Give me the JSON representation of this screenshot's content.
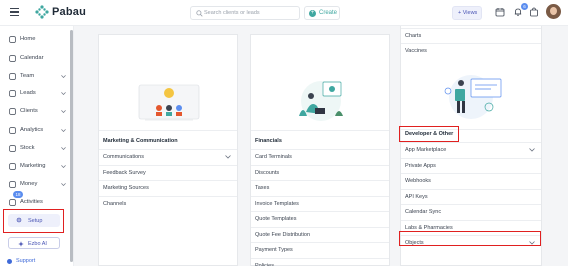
{
  "app": {
    "logo_text": "Pabau",
    "search_placeholder": "Search clients or leads",
    "create_label": "Create",
    "views_label": "+ Views",
    "notification_count": "6"
  },
  "sidebar": {
    "items": [
      {
        "label": "Home",
        "icon": "home-icon",
        "chevron": false
      },
      {
        "label": "Calendar",
        "icon": "calendar-icon",
        "chevron": false
      },
      {
        "label": "Team",
        "icon": "team-icon",
        "chevron": true
      },
      {
        "label": "Leads",
        "icon": "leads-icon",
        "chevron": true
      },
      {
        "label": "Clients",
        "icon": "clients-icon",
        "chevron": true
      },
      {
        "label": "Analytics",
        "icon": "analytics-icon",
        "chevron": true
      },
      {
        "label": "Stock",
        "icon": "stock-icon",
        "chevron": true
      },
      {
        "label": "Marketing",
        "icon": "marketing-icon",
        "chevron": true
      },
      {
        "label": "Money",
        "icon": "money-icon",
        "chevron": true
      },
      {
        "label": "Activities",
        "icon": "activities-icon",
        "chevron": false
      }
    ],
    "activities_badge": "18",
    "setup_label": "Setup",
    "ezbo_label": "Ezbo AI",
    "support_label": "Support"
  },
  "cards": {
    "marketing": {
      "heading": "Marketing & Communication",
      "items": [
        "Communications",
        "Feedback Survey",
        "Marketing Sources",
        "Channels"
      ]
    },
    "financials": {
      "heading": "Financials",
      "items": [
        "Card Terminals",
        "Discounts",
        "Taxes",
        "Invoice Templates",
        "Quote Templates",
        "Quote Fee Distribution",
        "Payment Types",
        "Policies"
      ]
    },
    "developer": {
      "top_items": [
        "Charts",
        "Vaccines"
      ],
      "heading": "Developer & Other",
      "items": [
        "App Marketplace",
        "Private Apps",
        "Webhooks",
        "API Keys",
        "Calendar Sync",
        "Labs & Pharmacies",
        "Objects"
      ]
    }
  },
  "colors": {
    "accent": "#3fa7a0",
    "brand_blue": "#4a55b5",
    "highlight": "#e02020"
  }
}
